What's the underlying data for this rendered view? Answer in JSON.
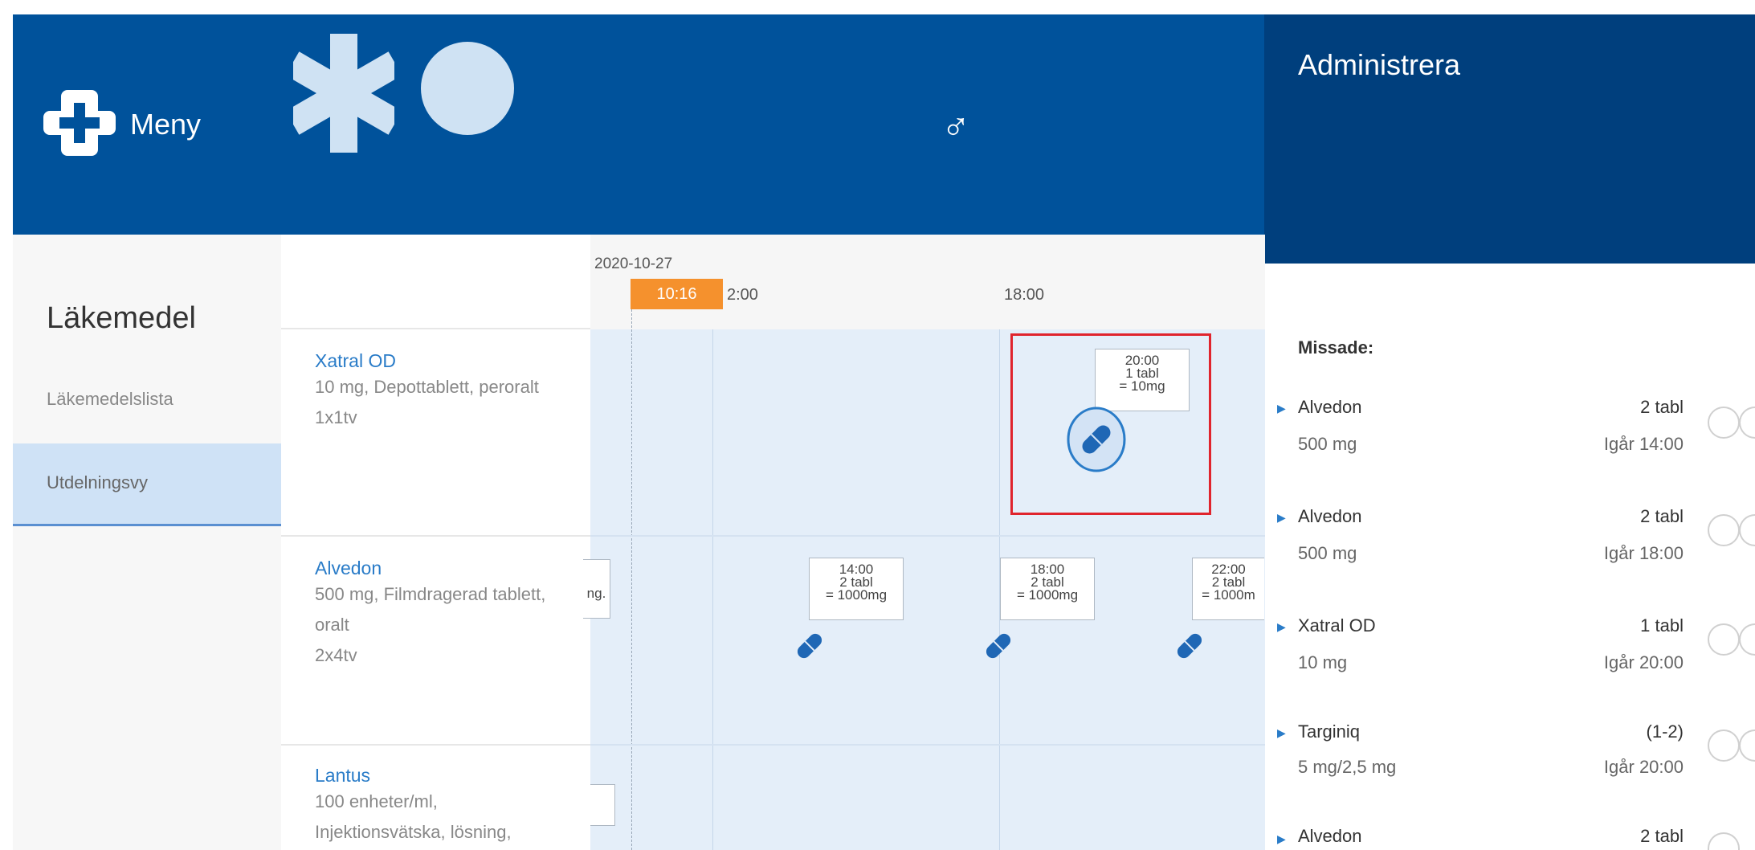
{
  "header": {
    "menu_label": "Meny",
    "gender_symbol": "♂",
    "admin_title": "Administrera",
    "icons": [
      "plus-icon",
      "star-of-life-icon",
      "avatar",
      "male-icon"
    ]
  },
  "sidebar": {
    "title": "Läkemedel",
    "items": [
      {
        "label": "Läkemedelslista",
        "active": false
      },
      {
        "label": "Utdelningsvy",
        "active": true
      }
    ]
  },
  "medications": [
    {
      "name": "Xatral OD",
      "line1": "10 mg, Depottablett, peroralt",
      "line2": "1x1tv"
    },
    {
      "name": "Alvedon",
      "line1": "500 mg, Filmdragerad tablett,",
      "line2": "oralt",
      "line3": "2x4tv"
    },
    {
      "name": "Lantus",
      "line1": "100 enheter/ml,",
      "line2": "Injektionsvätska, lösning,"
    }
  ],
  "timeline": {
    "date": "2020-10-27",
    "now": "10:16",
    "tick_1200": "2:00",
    "tick_1800": "18:00",
    "doses": {
      "xatral_2000": {
        "time": "20:00",
        "qty": "1 tabl",
        "amount": "= 10mg"
      },
      "alvedon_1400": {
        "time": "14:00",
        "qty": "2 tabl",
        "amount": "= 1000mg"
      },
      "alvedon_1800": {
        "time": "18:00",
        "qty": "2 tabl",
        "amount": "= 1000mg"
      },
      "alvedon_2200": {
        "time": "22:00",
        "qty": "2 tabl",
        "amount": "= 1000m"
      },
      "alvedon_prev": {
        "fragment": "ng."
      }
    }
  },
  "admin": {
    "missed_label": "Missade:",
    "items": [
      {
        "name": "Alvedon",
        "dose": "500 mg",
        "qty": "2 tabl",
        "time": "Igår 14:00"
      },
      {
        "name": "Alvedon",
        "dose": "500 mg",
        "qty": "2 tabl",
        "time": "Igår 18:00"
      },
      {
        "name": "Xatral OD",
        "dose": "10 mg",
        "qty": "1 tabl",
        "time": "Igår 20:00"
      },
      {
        "name": "Targiniq",
        "dose": "5 mg/2,5 mg",
        "qty": "(1-2)",
        "time": "Igår 20:00"
      },
      {
        "name": "Alvedon",
        "dose": "",
        "qty": "2 tabl",
        "time": ""
      }
    ]
  },
  "colors": {
    "header_blue": "#00529b",
    "admin_blue": "#003f7d",
    "accent_orange": "#f5912d",
    "highlight_red": "#e0242d",
    "link_blue": "#2a7cc8"
  }
}
